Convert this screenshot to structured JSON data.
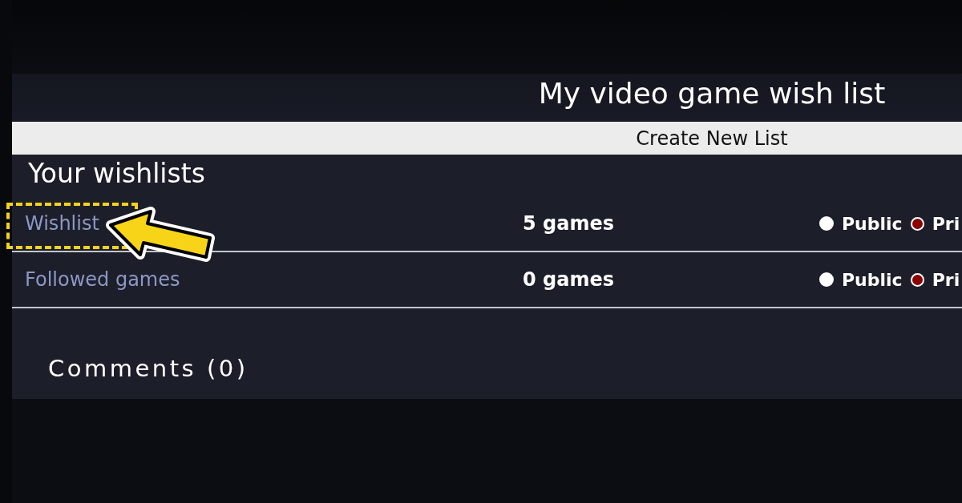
{
  "page": {
    "title": "My video game wish list"
  },
  "create_button": {
    "label": "Create New List"
  },
  "section_title": "Your wishlists",
  "lists": [
    {
      "name": "Wishlist",
      "count": "5 games",
      "highlighted": true,
      "visibility": [
        {
          "label": "Public",
          "selected": false
        },
        {
          "label": "Pri",
          "selected": true
        }
      ]
    },
    {
      "name": "Followed games",
      "count": "0 games",
      "highlighted": false,
      "visibility": [
        {
          "label": "Public",
          "selected": false
        },
        {
          "label": "Pri",
          "selected": true
        }
      ]
    }
  ],
  "comments": {
    "title": "Comments (0)"
  }
}
